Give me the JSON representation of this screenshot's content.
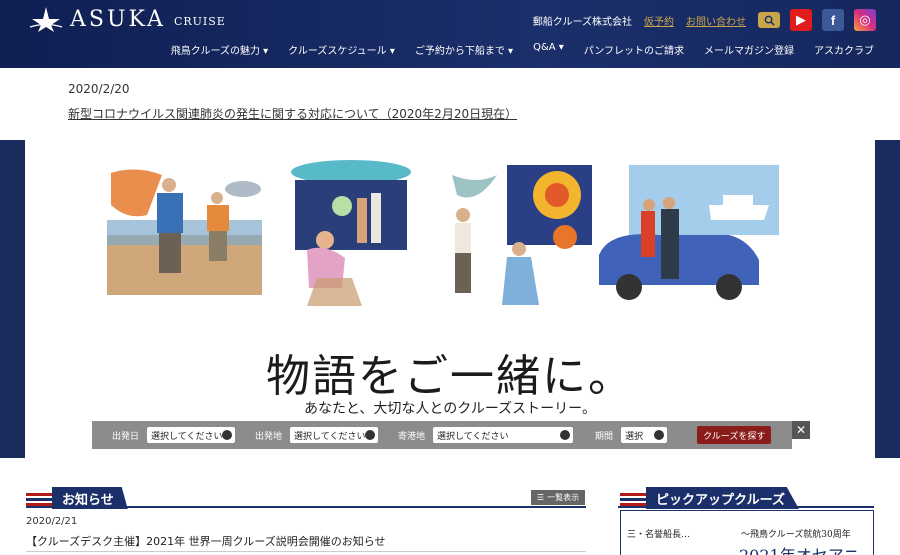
{
  "header": {
    "logo_text": "ASUKA",
    "logo_sub": "CRUISE",
    "company": "郵船クルーズ株式会社",
    "reserve_link": "仮予約",
    "contact_link": "お問い合わせ",
    "social": {
      "youtube": "▶",
      "facebook": "f",
      "instagram": "◎"
    },
    "nav": [
      "飛鳥クルーズの魅力 ▾",
      "クルーズスケジュール ▾",
      "ご予約から下船まで ▾",
      "Q&A ▾",
      "パンフレットのご請求",
      "メールマガジン登録",
      "アスカクラブ"
    ]
  },
  "notice": {
    "date": "2020/2/20",
    "link": "新型コロナウイルス関連肺炎の発生に関する対応について（2020年2月20日現在）"
  },
  "hero": {
    "headline": "物語をご一緒に。",
    "subline": "あなたと、大切な人とのクルーズストーリー。"
  },
  "search": {
    "departure_date_label": "出発日",
    "departure_date_value": "選択してください",
    "departure_port_label": "出発地",
    "departure_port_value": "選択してください",
    "stop_port_label": "寄港地",
    "stop_port_value": "選択してください",
    "period_label": "期間",
    "period_value": "選択",
    "submit": "クルーズを探す",
    "close": "✕"
  },
  "news": {
    "title": "お知らせ",
    "list_button": "一覧表示",
    "items": [
      {
        "date": "2020/2/21",
        "text": "【クルーズデスク主催】2021年 世界一周クルーズ説明会開催のお知らせ"
      }
    ]
  },
  "pickup": {
    "title": "ピックアップクルーズ",
    "left_text": "三・名誉船長…",
    "right_text": "～飛鳥クルーズ就航30周年",
    "big_text": "2021年オセアニ"
  },
  "colors": {
    "navy": "#1b2f6b",
    "gold": "#c9a64a",
    "button_red": "#8b1c1c"
  }
}
